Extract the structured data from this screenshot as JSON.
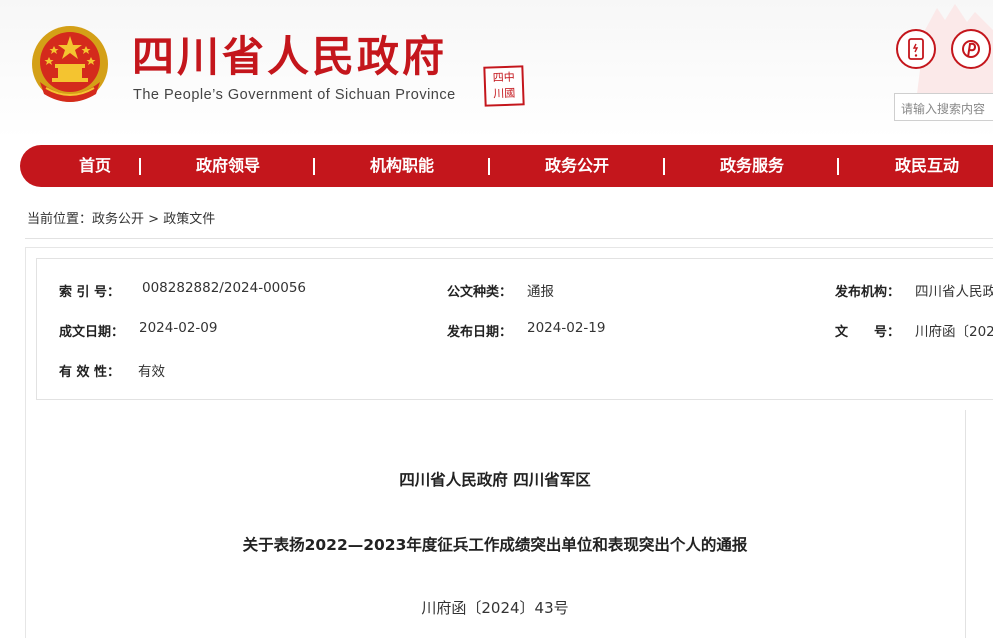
{
  "header": {
    "title": "四川省人民政府",
    "subtitle": "The People’s Government of Sichuan Province",
    "seal_text": "四川中國",
    "search_placeholder": "请输入搜索内容"
  },
  "nav": {
    "items": [
      {
        "label": "首页"
      },
      {
        "label": "政府领导"
      },
      {
        "label": "机构职能"
      },
      {
        "label": "政务公开"
      },
      {
        "label": "政务服务"
      },
      {
        "label": "政民互动"
      }
    ]
  },
  "breadcrumb": {
    "prefix": "当前位置：",
    "items": [
      "政务公开",
      "政策文件"
    ],
    "separator": ">"
  },
  "info": {
    "index_label": "索 引 号：",
    "index_value": "008282882/2024-00056",
    "doc_type_label": "公文种类：",
    "doc_type_value": "通报",
    "publisher_label": "发布机构：",
    "publisher_value": "四川省人民政",
    "written_date_label": "成文日期：",
    "written_date_value": "2024-02-09",
    "publish_date_label": "发布日期：",
    "publish_date_value": "2024-02-19",
    "doc_no_label": "文　　号：",
    "doc_no_value": "川府函〔202",
    "validity_label": "有 效 性：",
    "validity_value": "有效"
  },
  "document": {
    "issuer": "四川省人民政府 四川省军区",
    "title": "关于表扬2022—2023年度征兵工作成绩突出单位和表现突出个人的通报",
    "number": "川府函〔2024〕43号"
  },
  "colors": {
    "brand_red": "#c4161c"
  }
}
